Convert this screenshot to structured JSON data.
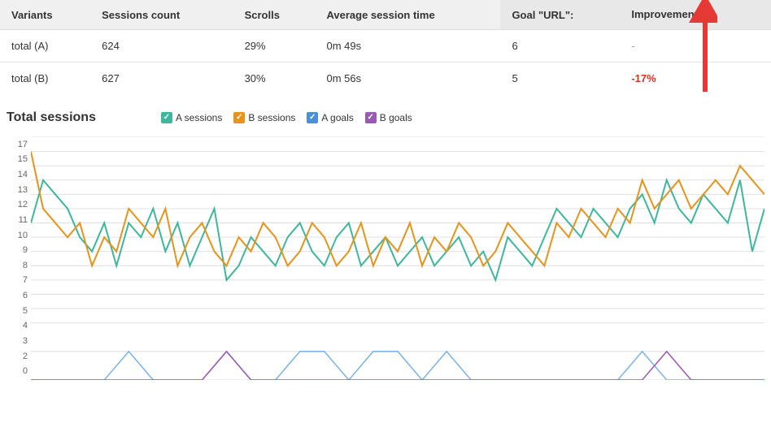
{
  "table": {
    "headers": [
      "Variants",
      "Sessions count",
      "Scrolls",
      "Average session time",
      "Goal \"URL\":",
      "Improvement"
    ],
    "rows": [
      {
        "variant": "total (A)",
        "sessions": "624",
        "scrolls": "29%",
        "avg_time": "0m 49s",
        "goal": "6",
        "improvement": "-"
      },
      {
        "variant": "total (B)",
        "sessions": "627",
        "scrolls": "30%",
        "avg_time": "0m 56s",
        "goal": "5",
        "improvement": "-17%"
      }
    ]
  },
  "chart": {
    "title": "Total sessions",
    "legend": [
      {
        "label": "A sessions",
        "color": "#3db89c",
        "type": "check"
      },
      {
        "label": "B sessions",
        "color": "#e8941a",
        "type": "check"
      },
      {
        "label": "A goals",
        "color": "#4a90d9",
        "type": "check"
      },
      {
        "label": "B goals",
        "color": "#9b59b6",
        "type": "check"
      }
    ],
    "y_labels": [
      "0",
      "2",
      "3",
      "4",
      "5",
      "6",
      "7",
      "8",
      "9",
      "10",
      "11",
      "12",
      "13",
      "14",
      "15",
      "17"
    ]
  }
}
